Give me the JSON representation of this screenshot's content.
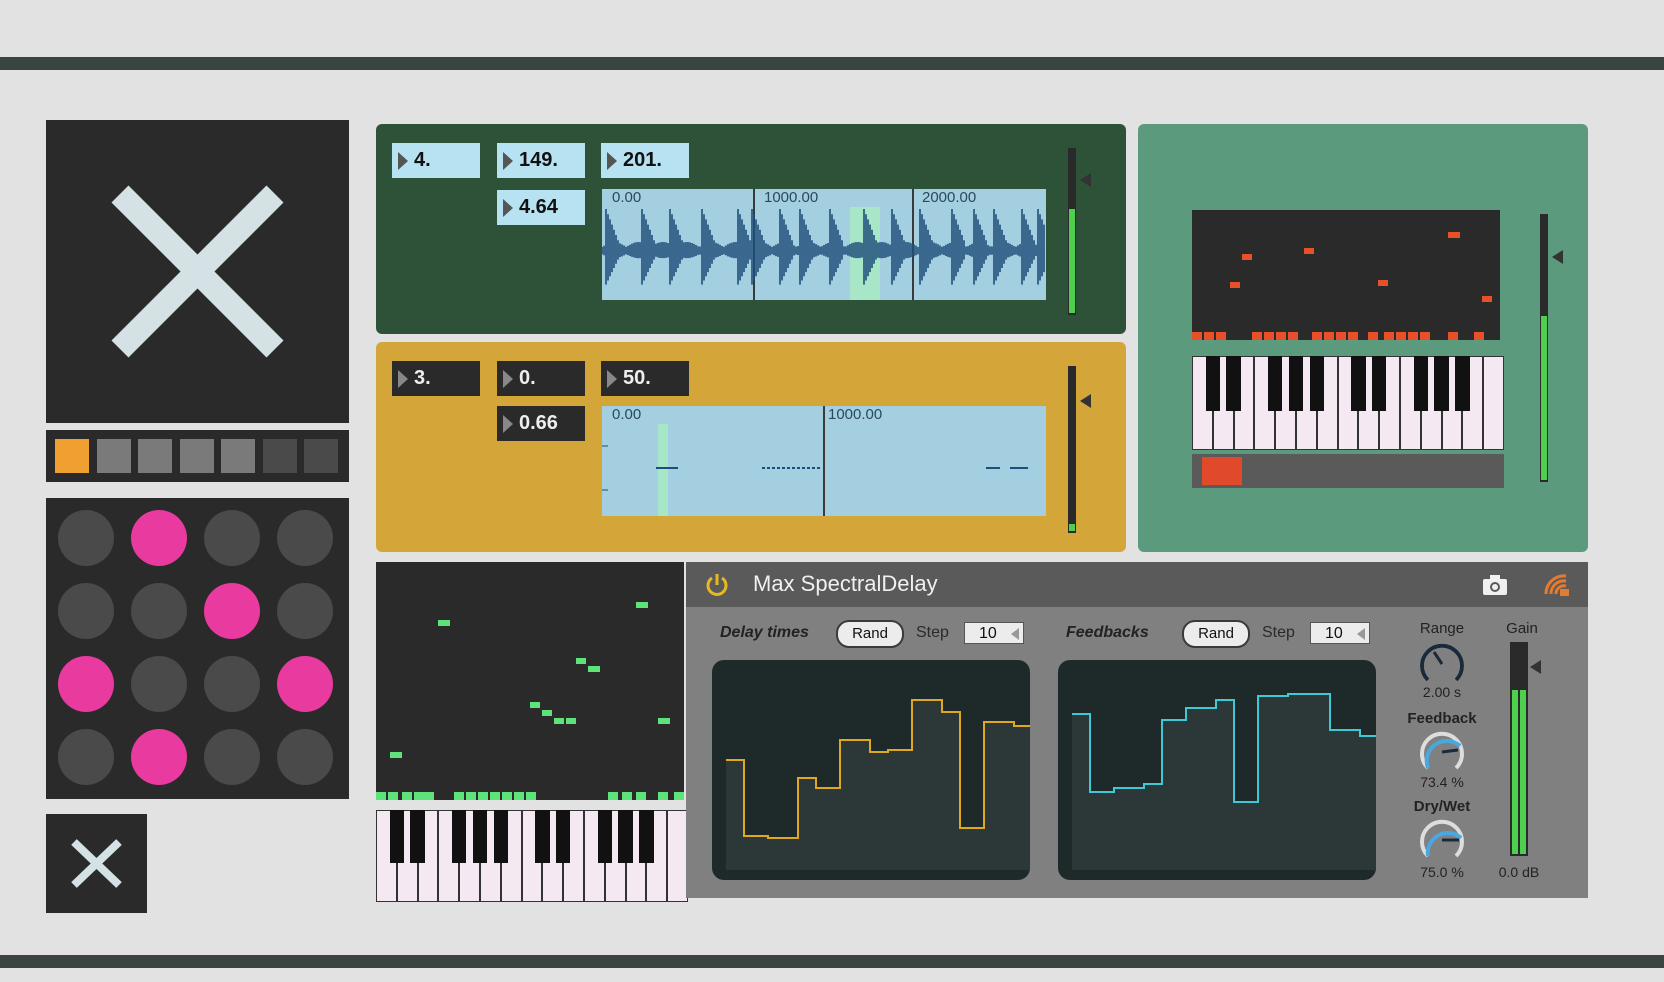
{
  "left": {
    "sequencer": {
      "steps": [
        "on",
        "mid",
        "mid",
        "mid",
        "mid",
        "off",
        "off"
      ]
    },
    "pad_grid": [
      [
        0,
        1,
        0,
        0
      ],
      [
        0,
        0,
        1,
        0
      ],
      [
        1,
        0,
        0,
        1
      ],
      [
        0,
        1,
        0,
        0
      ]
    ]
  },
  "sampler1": {
    "numbers": {
      "a": "4.",
      "b": "149.",
      "c": "201.",
      "d": "4.64"
    },
    "ruler": [
      "0.00",
      "1000.00",
      "2000.00"
    ],
    "meter_level": 0.64
  },
  "sampler2": {
    "numbers": {
      "a": "3.",
      "b": "0.",
      "c": "50.",
      "d": "0.66"
    },
    "ruler": [
      "0.00",
      "1000.00"
    ],
    "meter_level": 0.04
  },
  "synth": {
    "meter_level": 0.62
  },
  "spectral_delay": {
    "title": "Max SpectralDelay",
    "delay_times_label": "Delay times",
    "feedbacks_label": "Feedbacks",
    "rand_label": "Rand",
    "step_label": "Step",
    "step_value_1": "10",
    "step_value_2": "10",
    "range_label": "Range",
    "range_value": "2.00 s",
    "feedback_label": "Feedback",
    "feedback_value": "73.4 %",
    "drywet_label": "Dry/Wet",
    "drywet_value": "75.0 %",
    "gain_label": "Gain",
    "gain_value": "0.0 dB",
    "gain_meter_level": 0.78,
    "colors": {
      "delay": "#e0a81e",
      "feedback": "#3fc9d6",
      "power": "#e8b820"
    }
  }
}
